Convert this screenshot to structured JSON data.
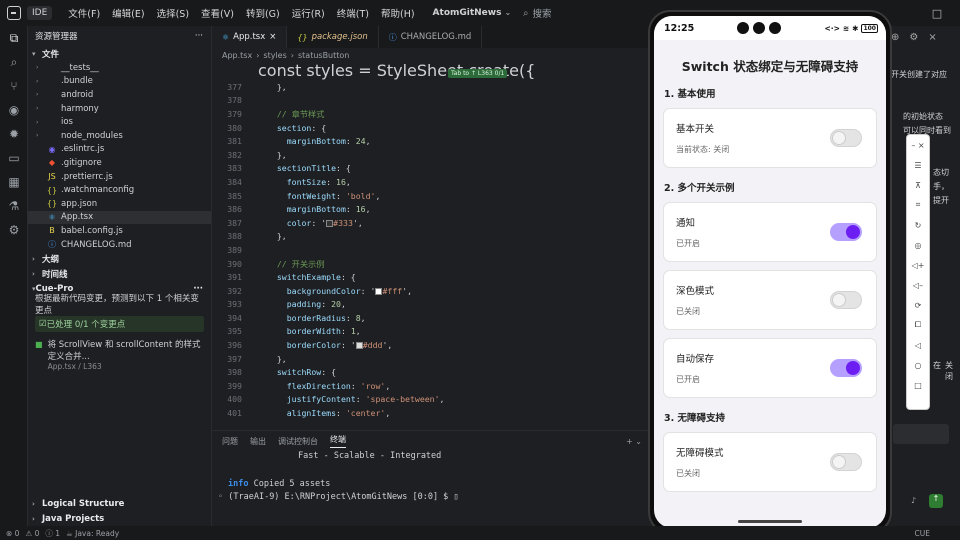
{
  "titlebar": {
    "ide_badge": "IDE",
    "menus": [
      "文件(F)",
      "编辑(E)",
      "选择(S)",
      "查看(V)",
      "转到(G)",
      "运行(R)",
      "终端(T)",
      "帮助(H)"
    ],
    "project": "AtomGitNews",
    "search_placeholder": "搜索"
  },
  "sidebar": {
    "title": "资源管理器",
    "files_section": "文件",
    "tree": [
      {
        "name": "__tests__",
        "type": "folder"
      },
      {
        "name": ".bundle",
        "type": "folder"
      },
      {
        "name": "android",
        "type": "folder"
      },
      {
        "name": "harmony",
        "type": "folder"
      },
      {
        "name": "ios",
        "type": "folder"
      },
      {
        "name": "node_modules",
        "type": "folder"
      },
      {
        "name": ".eslintrc.js",
        "type": "eslint"
      },
      {
        "name": ".gitignore",
        "type": "git"
      },
      {
        "name": ".prettierrc.js",
        "type": "js"
      },
      {
        "name": ".watchmanconfig",
        "type": "json"
      },
      {
        "name": "app.json",
        "type": "json"
      },
      {
        "name": "App.tsx",
        "type": "tsx"
      },
      {
        "name": "babel.config.js",
        "type": "babel"
      },
      {
        "name": "CHANGELOG.md",
        "type": "md"
      }
    ],
    "outline": "大纲",
    "timeline": "时间线",
    "cue_title": "Cue-Pro",
    "cue_desc": "根据最新代码变更，预测到以下 1 个相关变更点",
    "cue_status": "已处理 0/1 个变更点",
    "cue_item": "将 ScrollView 和 scrollContent 的样式定义合并...",
    "cue_item_sub": "App.tsx / L363",
    "logical": "Logical Structure",
    "java": "Java Projects"
  },
  "editor": {
    "tabs": [
      {
        "label": "App.tsx",
        "kind": "tsx"
      },
      {
        "label": "package.json",
        "kind": "json"
      },
      {
        "label": "CHANGELOG.md",
        "kind": "md"
      }
    ],
    "breadcrumb": [
      "App.tsx",
      "styles",
      "statusButton"
    ],
    "sticky": "const styles = StyleSheet.create({",
    "tab_hint": "Tab to ↑ L363  0/1",
    "lines": [
      {
        "n": "377",
        "t": "  },"
      },
      {
        "n": "378",
        "t": ""
      },
      {
        "n": "379",
        "t": "  // 章节样式"
      },
      {
        "n": "380",
        "t": "  section: {"
      },
      {
        "n": "381",
        "t": "    marginBottom: 24,"
      },
      {
        "n": "382",
        "t": "  },"
      },
      {
        "n": "383",
        "t": "  sectionTitle: {"
      },
      {
        "n": "384",
        "t": "    fontSize: 16,"
      },
      {
        "n": "385",
        "t": "    fontWeight: 'bold',"
      },
      {
        "n": "386",
        "t": "    marginBottom: 16,"
      },
      {
        "n": "387",
        "t": "    color: '#333',"
      },
      {
        "n": "388",
        "t": "  },"
      },
      {
        "n": "389",
        "t": ""
      },
      {
        "n": "390",
        "t": "  // 开关示例"
      },
      {
        "n": "391",
        "t": "  switchExample: {"
      },
      {
        "n": "392",
        "t": "    backgroundColor: '#fff',"
      },
      {
        "n": "393",
        "t": "    padding: 20,"
      },
      {
        "n": "394",
        "t": "    borderRadius: 8,"
      },
      {
        "n": "395",
        "t": "    borderWidth: 1,"
      },
      {
        "n": "396",
        "t": "    borderColor: '#ddd',"
      },
      {
        "n": "397",
        "t": "  },"
      },
      {
        "n": "398",
        "t": "  switchRow: {"
      },
      {
        "n": "399",
        "t": "    flexDirection: 'row',"
      },
      {
        "n": "400",
        "t": "    justifyContent: 'space-between',"
      },
      {
        "n": "401",
        "t": "    alignItems: 'center',"
      }
    ]
  },
  "panel": {
    "tabs": [
      "问题",
      "输出",
      "调试控制台",
      "终端"
    ],
    "active_tab": "终端",
    "term_line1": "Fast - Scalable - Integrated",
    "term_info": "info",
    "term_line2": " Copied 5 assets",
    "term_prompt": "(TraeAI-9) E:\\RNProject\\AtomGitNews [0:0] $ "
  },
  "statusbar": {
    "errors": "0",
    "warnings": "0",
    "info": "1",
    "java": "Java: Ready",
    "cue": "CUE"
  },
  "phone": {
    "time": "12:25",
    "battery": "100",
    "title": "Switch 状态绑定与无障碍支持",
    "sections": [
      {
        "title": "1. 基本使用",
        "cards": [
          {
            "label": "基本开关",
            "status": "当前状态: 关闭",
            "on": false
          }
        ]
      },
      {
        "title": "2. 多个开关示例",
        "cards": [
          {
            "label": "通知",
            "status": "已开启",
            "on": true
          },
          {
            "label": "深色模式",
            "status": "已关闭",
            "on": false
          },
          {
            "label": "自动保存",
            "status": "已开启",
            "on": true
          }
        ]
      },
      {
        "title": "3. 无障碍支持",
        "cards": [
          {
            "label": "无障碍模式",
            "status": "已关闭",
            "on": false
          }
        ]
      }
    ]
  },
  "rightpanel": {
    "snippets": [
      "开关创建了对应",
      "的初始状态",
      "可以同时看到",
      "态切",
      "手，",
      "提开",
      "在",
      "关闭"
    ]
  },
  "colors": {
    "accent_purple": "#6d1ff3",
    "track_on": "#b5a0ff"
  }
}
